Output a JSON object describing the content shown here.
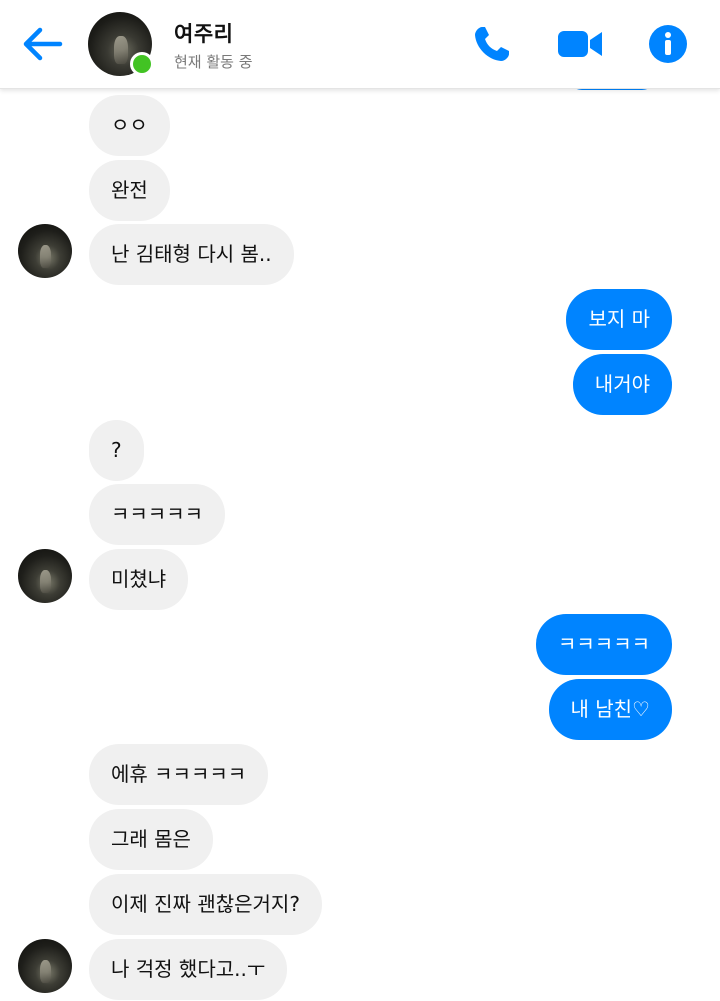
{
  "header": {
    "contact_name": "여주리",
    "status": "현재 활동 중",
    "back_icon": "arrow-left-icon",
    "call_icon": "phone-icon",
    "video_icon": "video-camera-icon",
    "info_icon": "info-icon",
    "accent_color": "#0084ff",
    "online_color": "#42c323"
  },
  "messages": [
    {
      "side": "in",
      "text": "ㅇㅇ"
    },
    {
      "side": "in",
      "text": "완전"
    },
    {
      "side": "in",
      "text": "난 김태형 다시 봄..",
      "avatar": true
    },
    {
      "side": "out",
      "text": "보지 마"
    },
    {
      "side": "out",
      "text": "내거야"
    },
    {
      "side": "in",
      "text": "?"
    },
    {
      "side": "in",
      "text": "ㅋㅋㅋㅋㅋ"
    },
    {
      "side": "in",
      "text": "미쳤냐",
      "avatar": true
    },
    {
      "side": "out",
      "text": "ㅋㅋㅋㅋㅋ"
    },
    {
      "side": "out",
      "text": "내 남친♡"
    },
    {
      "side": "in",
      "text": "에휴 ㅋㅋㅋㅋㅋ"
    },
    {
      "side": "in",
      "text": "그래 몸은"
    },
    {
      "side": "in",
      "text": "이제 진짜 괜찮은거지?"
    },
    {
      "side": "in",
      "text": "나 걱정 했다고..ㅜ",
      "avatar": true
    }
  ],
  "colors": {
    "incoming_bubble": "#f0f0f0",
    "outgoing_bubble": "#0084ff",
    "outgoing_text": "#ffffff",
    "incoming_text": "#111111"
  }
}
